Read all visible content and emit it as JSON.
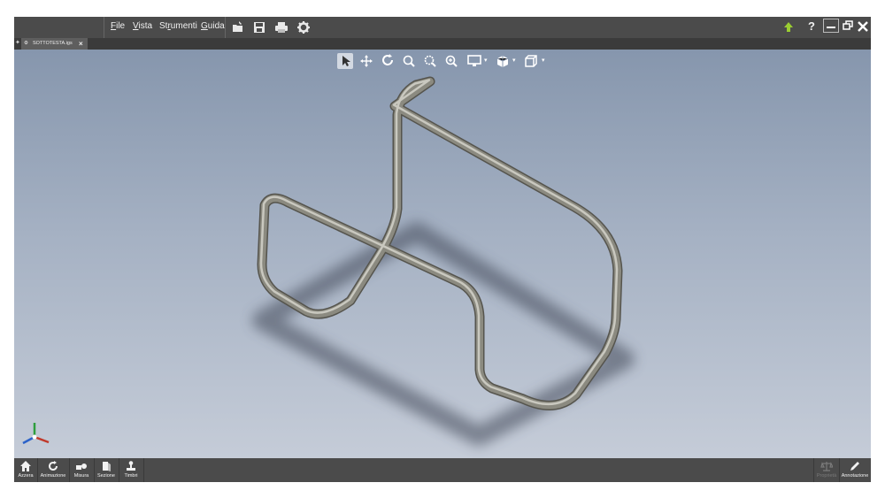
{
  "menu": {
    "items": [
      {
        "label": "File",
        "u": "F",
        "rest": "ile"
      },
      {
        "label": "Vista",
        "u": "V",
        "rest": "ista"
      },
      {
        "label": "Strumenti",
        "pre": "St",
        "u": "r",
        "rest": "umenti"
      },
      {
        "label": "Guida",
        "u": "G",
        "rest": "uida"
      }
    ],
    "help_label": "?"
  },
  "tab": {
    "label": "SOTTOTESTA.igs",
    "close": "×"
  },
  "bottom_left": [
    {
      "label": "Azzera",
      "icon": "home-icon"
    },
    {
      "label": "Animazione",
      "icon": "rotate-icon"
    },
    {
      "label": "Misura",
      "icon": "measure-icon"
    },
    {
      "label": "Sezione",
      "icon": "section-icon"
    },
    {
      "label": "Timbri",
      "icon": "stamp-icon"
    }
  ],
  "bottom_right": [
    {
      "label": "Proprietà",
      "icon": "balance-icon",
      "enabled": false
    },
    {
      "label": "Annotazione",
      "icon": "pencil-icon",
      "enabled": true
    }
  ],
  "colors": {
    "bar": "#4b4b4b",
    "viewport_top": "#8696ad",
    "viewport_bottom": "#c5ccd8",
    "tube": "#8b8a80",
    "upload_arrow": "#9acd32"
  }
}
